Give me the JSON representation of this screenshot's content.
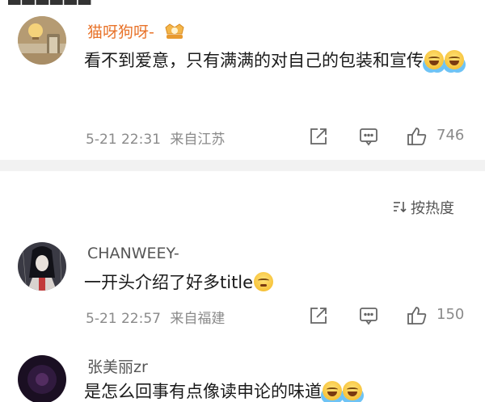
{
  "comments": [
    {
      "username": "猫呀狗呀-",
      "username_color": "#e8732a",
      "text": "看不到爱意，只有满满的对自己的包装和宣传",
      "emojis": [
        "laugh-cry-emoji",
        "laugh-cry-emoji"
      ],
      "date": "5-21 22:31",
      "location": "来自江苏",
      "likes": "746"
    },
    {
      "username": "CHANWEEY-",
      "username_color": "#555555",
      "text": "一开头介绍了好多title",
      "emojis": [
        "shy-emoji"
      ],
      "date": "5-21 22:57",
      "location": "来自福建",
      "likes": "150"
    },
    {
      "username": "张美丽zr",
      "username_color": "#555555",
      "text": "是怎么回事有点像读申论的味道",
      "emojis": [
        "laugh-cry-emoji",
        "laugh-cry-emoji"
      ]
    }
  ],
  "sort": {
    "label": "按热度"
  },
  "icons": {
    "share": "share-icon",
    "comment": "comment-icon",
    "like": "thumbs-up-icon",
    "sort": "sort-icon"
  }
}
